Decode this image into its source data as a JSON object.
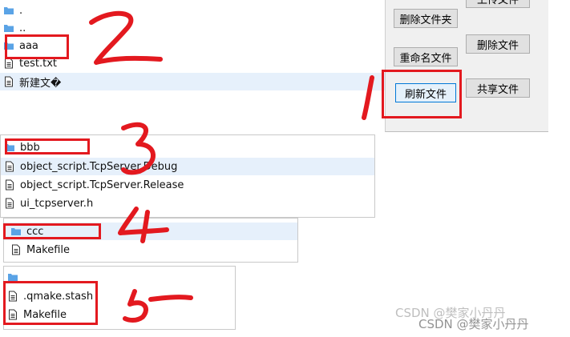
{
  "panel1": {
    "items": [
      ".",
      "..",
      "aaa",
      "test.txt",
      "新建文�"
    ],
    "buttons": {
      "top_partial": "上传文件",
      "delete_folder": "删除文件夹",
      "delete_file": "删除文件",
      "rename_file": "重命名文件",
      "refresh_file": "刷新文件",
      "share_file": "共享文件"
    }
  },
  "panel2": {
    "items": [
      "bbb",
      "object_script.TcpServer.Debug",
      "object_script.TcpServer.Release",
      "ui_tcpserver.h"
    ]
  },
  "panel3": {
    "items": [
      "ccc",
      "Makefile"
    ]
  },
  "panel4": {
    "items": [
      ".qmake.stash",
      "Makefile"
    ]
  },
  "annotations": [
    "2",
    "1",
    "3",
    "4",
    "5"
  ],
  "watermark": "CSDN @樊家小丹丹",
  "colors": {
    "annotation_red": "#e3191f",
    "selection": "#e6f0fb",
    "folder_blue": "#5aa3e6"
  }
}
